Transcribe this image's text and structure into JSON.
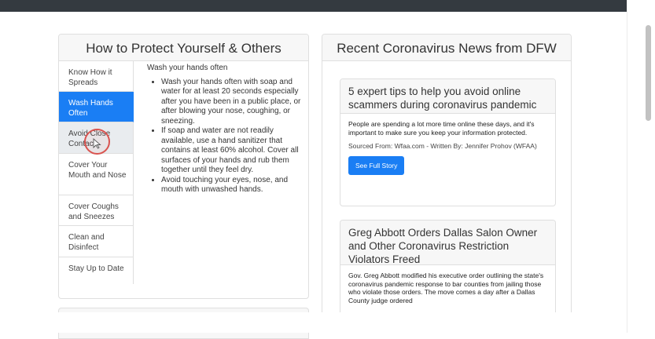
{
  "left_card": {
    "title": "How to Protect Yourself & Others",
    "nav": [
      {
        "label": "Know How it Spreads",
        "state": "normal"
      },
      {
        "label": "Wash Hands Often",
        "state": "active"
      },
      {
        "label": "Avoid Close Contact",
        "state": "hover"
      },
      {
        "label": "Cover Your Mouth and Nose",
        "state": "normal"
      },
      {
        "label": "Cover Coughs and Sneezes",
        "state": "normal"
      },
      {
        "label": "Clean and Disinfect",
        "state": "normal"
      },
      {
        "label": "Stay Up to Date",
        "state": "normal"
      }
    ],
    "content": {
      "heading": "Wash your hands often",
      "bullets": [
        "Wash your hands often with soap and water for at least 20 seconds especially after you have been in a public place, or after blowing your nose, coughing, or sneezing.",
        "If soap and water are not readily available, use a hand sanitizer that contains at least 60% alcohol. Cover all surfaces of your hands and rub them together until they feel dry.",
        "Avoid touching your eyes, nose, and mouth with unwashed hands."
      ]
    }
  },
  "right_card": {
    "title": "Recent Coronavirus News from DFW",
    "news": [
      {
        "title": "5 expert tips to help you avoid online scammers during coronavirus pandemic",
        "summary": "People are spending a lot more time online these days, and it's important to make sure you keep your information protected.",
        "source": "Sourced From: Wfaa.com - Written By: Jennifer Prohov (WFAA)",
        "button": "See Full Story"
      },
      {
        "title": "Greg Abbott Orders Dallas Salon Owner and Other Coronavirus Restriction Violators Freed",
        "summary": "Gov. Greg Abbott modified his executive order outlining the state's coronavirus pandemic response to bar counties from jailing those who violate those orders. The move comes a day after a Dallas County judge ordered"
      }
    ]
  },
  "colors": {
    "accent": "#1a7ef4",
    "topbar": "#343a40",
    "cursor_ring": "#d9534f"
  }
}
